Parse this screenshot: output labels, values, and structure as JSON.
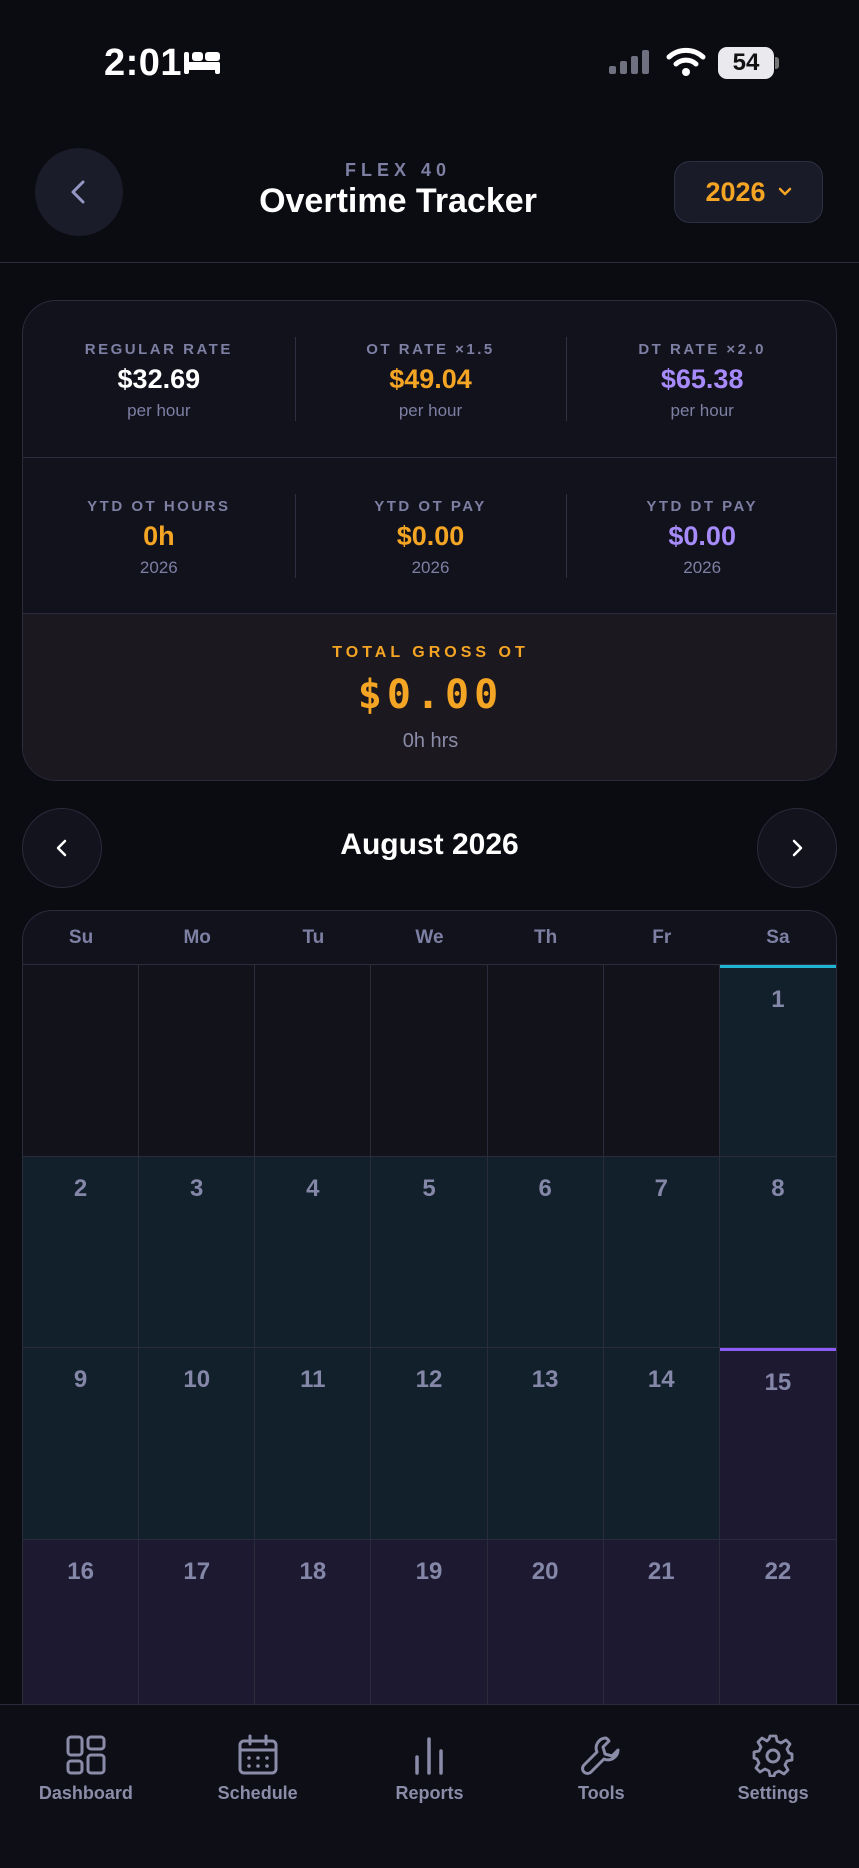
{
  "status": {
    "time": "2:01",
    "battery": "54"
  },
  "header": {
    "subtitle": "FLEX 40",
    "title": "Overtime Tracker",
    "year": "2026"
  },
  "rates": [
    {
      "label": "REGULAR RATE",
      "value": "$32.69",
      "sub": "per hour",
      "color": "#ffffff"
    },
    {
      "label": "OT RATE ×1.5",
      "value": "$49.04",
      "sub": "per hour",
      "color": "#f5a524"
    },
    {
      "label": "DT RATE ×2.0",
      "value": "$65.38",
      "sub": "per hour",
      "color": "#a78bfa"
    }
  ],
  "ytd": [
    {
      "label": "YTD OT HOURS",
      "value": "0h",
      "sub": "2026",
      "color": "#f5a524"
    },
    {
      "label": "YTD OT PAY",
      "value": "$0.00",
      "sub": "2026",
      "color": "#f5a524"
    },
    {
      "label": "YTD DT PAY",
      "value": "$0.00",
      "sub": "2026",
      "color": "#a78bfa"
    }
  ],
  "total": {
    "label": "TOTAL GROSS OT",
    "value": "$0.00",
    "hours": "0h hrs"
  },
  "calendar": {
    "month": "August 2026",
    "weekdays": [
      "Su",
      "Mo",
      "Tu",
      "We",
      "Th",
      "Fr",
      "Sa"
    ],
    "weeks": [
      [
        "",
        "",
        "",
        "",
        "",
        "",
        "1"
      ],
      [
        "2",
        "3",
        "4",
        "5",
        "6",
        "7",
        "8"
      ],
      [
        "9",
        "10",
        "11",
        "12",
        "13",
        "14",
        "15"
      ],
      [
        "16",
        "17",
        "18",
        "19",
        "20",
        "21",
        "22"
      ]
    ]
  },
  "tabs": [
    {
      "label": "Dashboard",
      "icon": "dashboard-icon"
    },
    {
      "label": "Schedule",
      "icon": "calendar-icon"
    },
    {
      "label": "Reports",
      "icon": "bar-chart-icon"
    },
    {
      "label": "Tools",
      "icon": "wrench-icon"
    },
    {
      "label": "Settings",
      "icon": "gear-icon"
    }
  ],
  "colors": {
    "background": "#0b0b12",
    "card": "#12121d",
    "accent_orange": "#f5a524",
    "accent_purple": "#a78bfa",
    "accent_teal": "#1fb4d1",
    "muted_text": "#7d7fa3"
  }
}
